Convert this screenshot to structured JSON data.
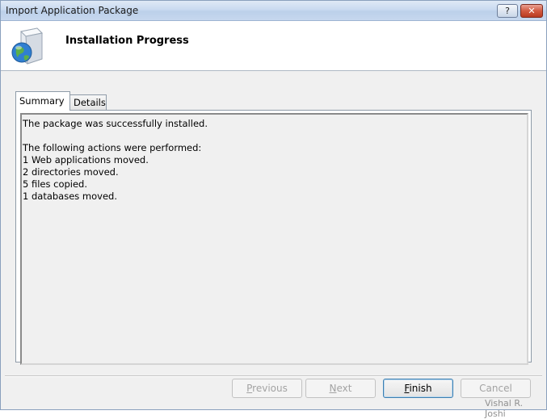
{
  "window": {
    "title": "Import Application Package",
    "help_label": "?",
    "close_label": "✕"
  },
  "header": {
    "title": "Installation Progress",
    "icon": "package-globe-icon"
  },
  "tabs": [
    {
      "label": "Summary",
      "active": true
    },
    {
      "label": "Details",
      "active": false
    }
  ],
  "summary_text": "The package was successfully installed.\n\nThe following actions were performed:\n1 Web applications moved.\n2 directories moved.\n5 files copied.\n1 databases moved.",
  "buttons": {
    "previous": {
      "label_accel": "P",
      "label_rest": "revious",
      "enabled": false
    },
    "next": {
      "label_accel": "N",
      "label_rest": "ext",
      "enabled": false
    },
    "finish": {
      "label_accel": "F",
      "label_rest": "inish",
      "enabled": true
    },
    "cancel": {
      "label": "Cancel",
      "enabled": false
    }
  },
  "watermark": "Vishal R. Joshi"
}
